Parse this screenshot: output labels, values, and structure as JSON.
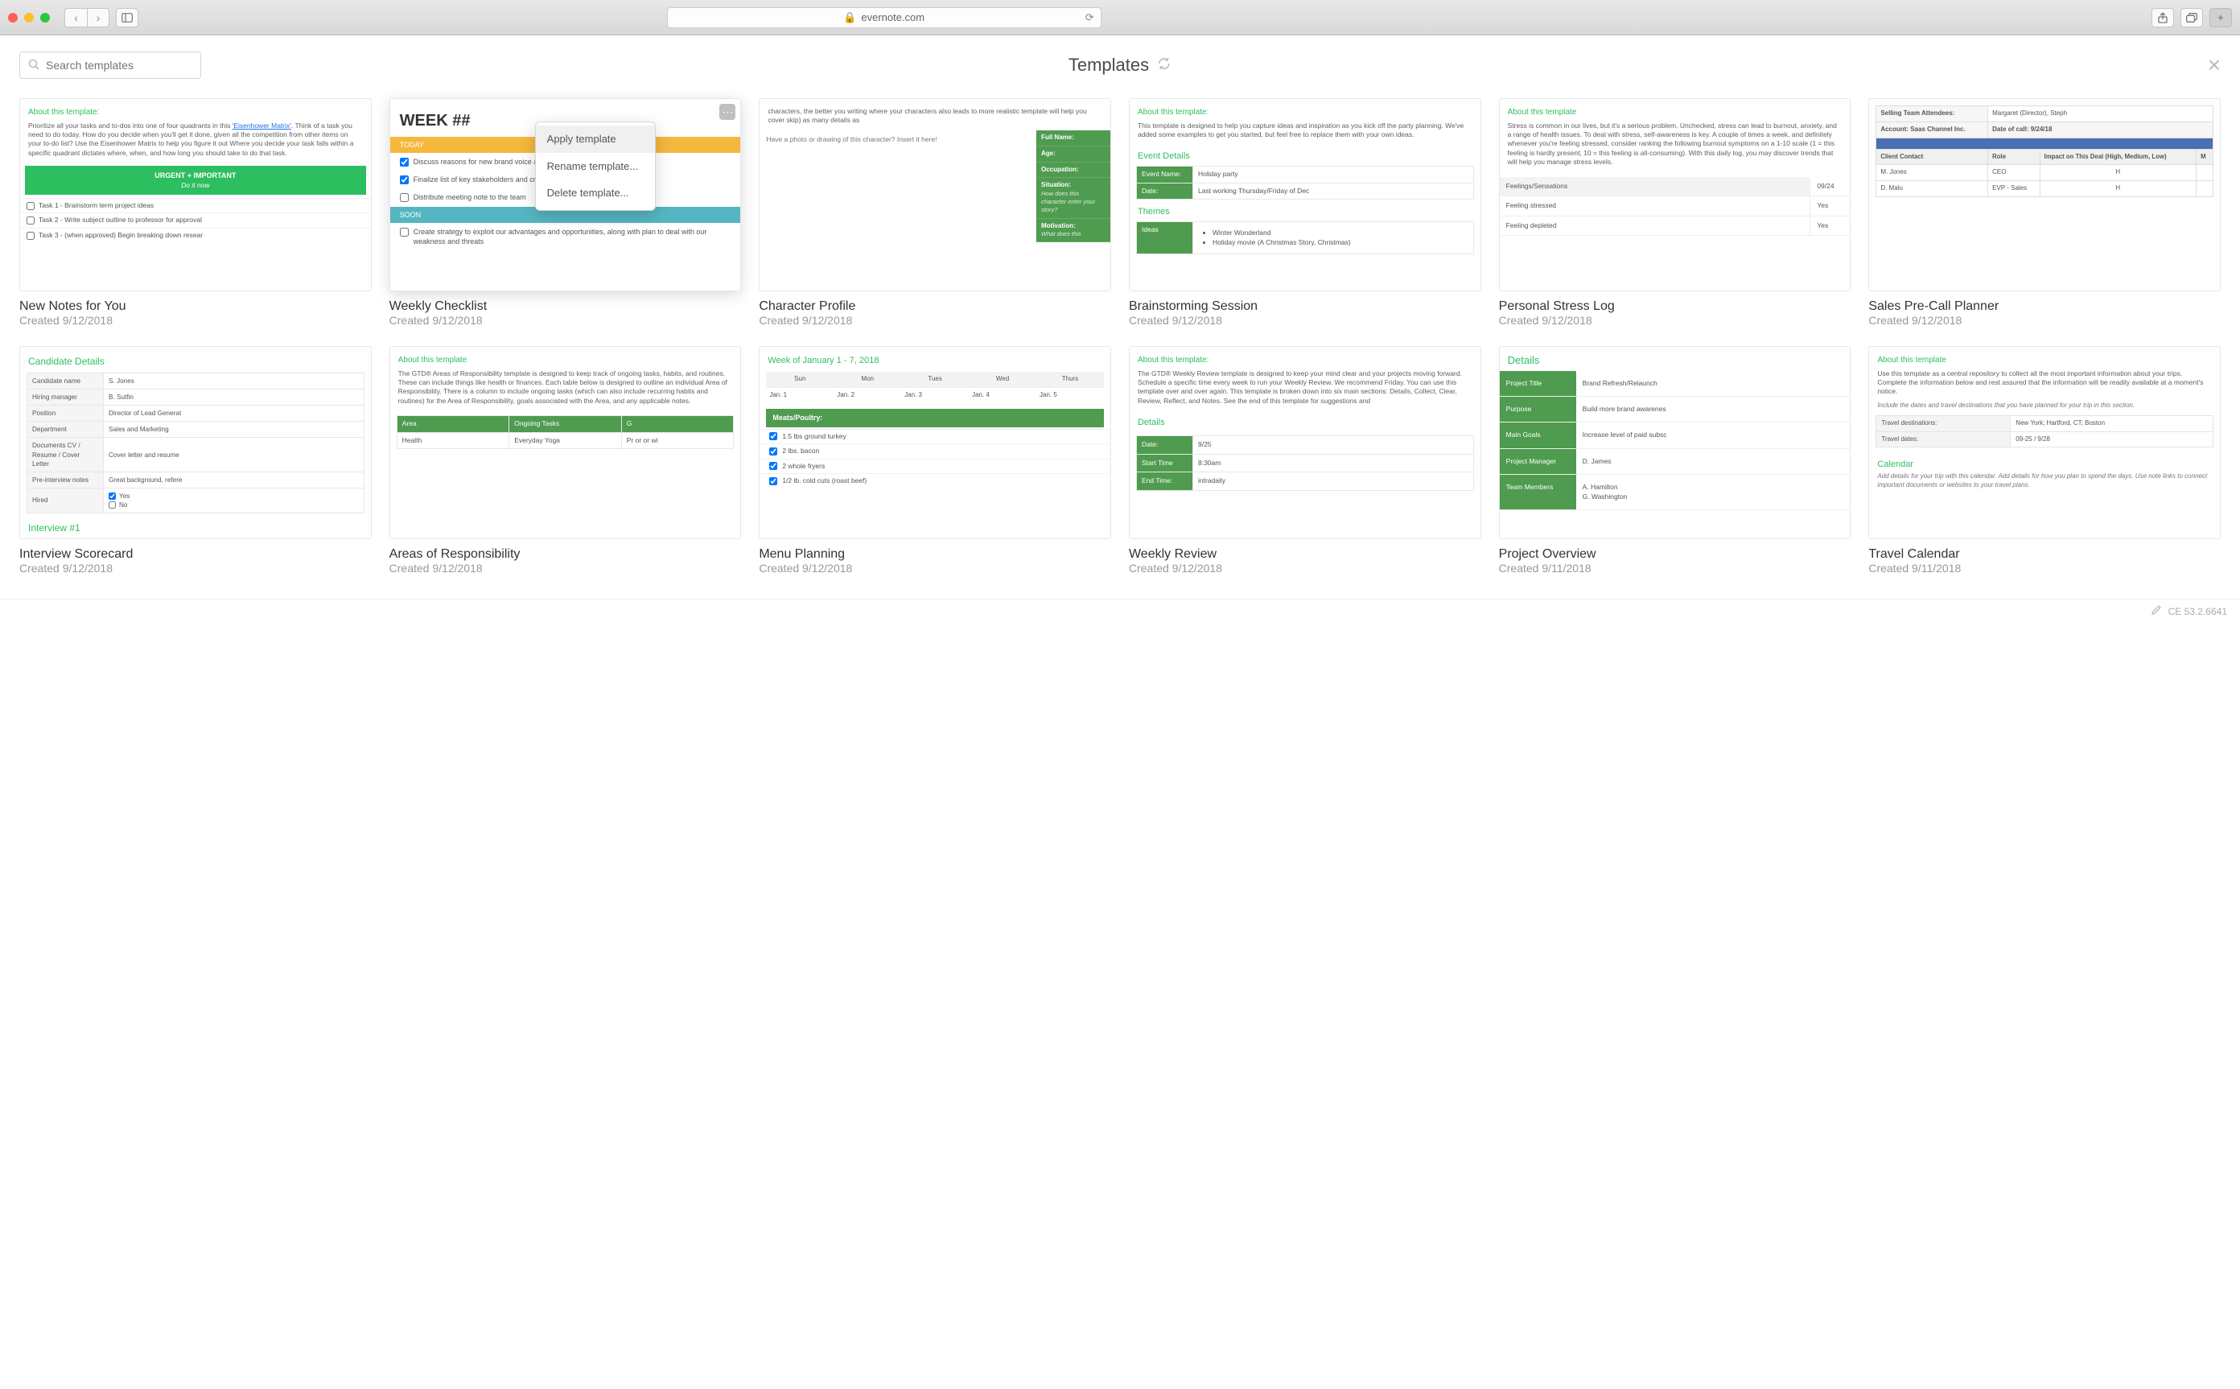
{
  "browser": {
    "url": "evernote.com",
    "share_icon": "share-icon",
    "tabs_icon": "tabs-icon"
  },
  "header": {
    "search_placeholder": "Search templates",
    "title": "Templates"
  },
  "context_menu": {
    "apply": "Apply template",
    "rename": "Rename template...",
    "delete": "Delete template..."
  },
  "footer": {
    "version": "CE 53.2.6641"
  },
  "cards": {
    "new_notes": {
      "title": "New Notes for You",
      "created": "Created 9/12/2018",
      "about": "About this template:",
      "body_pre": "Prioritize all your tasks and to-dos into one of four quadrants in this ",
      "link": "'Eisenhower Matrix'",
      "body_post": ". Think of a task you need to do today. How do you decide when you'll get it done, given all the competition from other items on your to-do list? Use the Eisenhower Matrix to help you figure it out Where you decide your task falls within a specific quadrant dictates where, when, and how long you should take to do that task.",
      "urgent": "URGENT + IMPORTANT",
      "urgent_sub": "Do it now",
      "task1": "Task 1 - Brainstorm term project ideas",
      "task2": "Task 2 - Write subject outline to professor for approval",
      "task3": "Task 3 - (when approved) Begin breaking down resear"
    },
    "weekly_checklist": {
      "title": "Weekly Checklist",
      "created": "Created 9/12/2018",
      "heading": "WEEK ##",
      "today": "TODAY",
      "t1": "Discuss reasons for new brand voice and design for website/app",
      "t2": "Finalize list of key stakeholders and creative team",
      "t3": "Distribute meeting note to the team",
      "soon": "SOON",
      "s1": "Create strategy to exploit our advantages and opportunities, along with plan to deal with our weakness and threats"
    },
    "character_profile": {
      "title": "Character Profile",
      "created": "Created 9/12/2018",
      "body": "characters, the better you writing where your characters also leads to more realistic template will help you cover skip) as many details as",
      "photo": "Have a photo or drawing of this character? Insert it here!",
      "fields": {
        "fullname": "Full Name:",
        "age": "Age:",
        "occupation": "Occupation:",
        "situation": "Situation:",
        "situation_q": "How does this character enter your story?",
        "motivation": "Motivation:",
        "motivation_q": "What does this"
      }
    },
    "brainstorming": {
      "title": "Brainstorming Session",
      "created": "Created 9/12/2018",
      "about": "About this template:",
      "body": "This template is designed to help you capture ideas and inspiration as you kick off the party planning. We've added some examples to get you started, but feel free to replace them with your own ideas.",
      "event_details": "Event Details",
      "event_name_k": "Event Name:",
      "event_name_v": "Holiday party",
      "date_k": "Date:",
      "date_v": "Last working Thursday/Friday of Dec",
      "themes": "Themes",
      "ideas_k": "Ideas",
      "idea1": "Winter Wonderland",
      "idea2": "Holiday movie (A Christmas Story, Christmas)"
    },
    "stress_log": {
      "title": "Personal Stress Log",
      "created": "Created 9/12/2018",
      "about": "About this template",
      "body": "Stress is common in our lives, but it's a serious problem. Unchecked, stress can lead to burnout, anxiety, and a range of health issues. To deal with stress, self-awareness is key. A couple of times a week, and definitely whenever you're feeling stressed, consider ranking the following burnout symptoms on a 1-10 scale (1 = this feeling is hardly present; 10 = this feeling is all-consuming). With this daily log, you may discover trends that will help you manage stress levels.",
      "date": "09/24",
      "feelings_h": "Feelings/Sensations",
      "r1k": "Feeling stressed",
      "r1v": "Yes",
      "r2k": "Feeling depleted",
      "r2v": "Yes"
    },
    "sales": {
      "title": "Sales Pre-Call Planner",
      "created": "Created 9/12/2018",
      "attendees_k": "Selling Team Attendees:",
      "attendees_v": "Margaret (Director), Steph",
      "account_k": "Account: Saas Channel Inc.",
      "datecall_k": "Date of call: 9/24/18",
      "col1": "Client Contact",
      "col2": "Role",
      "col3": "Impact on This Deal (High, Medium, Low)",
      "col4": "M",
      "r1c1": "M. Jones",
      "r1c2": "CEO",
      "r1c3": "H",
      "r2c1": "D. Malu",
      "r2c2": "EVP - Sales",
      "r2c3": "H"
    },
    "interview": {
      "title": "Interview Scorecard",
      "created": "Created 9/12/2018",
      "details": "Candidate Details",
      "rows": {
        "name_k": "Candidate name",
        "name_v": "S. Jones",
        "hm_k": "Hiring manager",
        "hm_v": "B. Sutfin",
        "pos_k": "Position",
        "pos_v": "Director of Lead Generat",
        "dept_k": "Department",
        "dept_v": "Sales and Marketing",
        "docs_k": "Documents CV / Resume / Cover Letter",
        "docs_v": "Cover letter and resume",
        "notes_k": "Pre-interview notes",
        "notes_v": "Great background, refere",
        "hired_k": "Hired",
        "hired_yes": "Yes",
        "hired_no": "No"
      },
      "interview1": "Interview #1"
    },
    "areas": {
      "title": "Areas of Responsibility",
      "created": "Created 9/12/2018",
      "about": "About this template",
      "body": "The GTD® Areas of Responsibility template is designed to keep track of ongoing tasks, habits, and routines. These can include things like health or finances. Each table below is designed to outline an individual Area of Responsibility. There is a column to include ongoing tasks (which can also include recurring habits and routines) for the Area of Responsibility, goals associated with the Area, and any applicable notes.",
      "col1": "Area",
      "col2": "Ongoing Tasks",
      "col3": "G",
      "r1c1": "Health",
      "r1c2": "Everyday Yoga",
      "r1c3": "Pr or or wi"
    },
    "menu": {
      "title": "Menu Planning",
      "created": "Created 9/12/2018",
      "week": "Week of January 1 - 7, 2018",
      "days": [
        "Sun",
        "Mon",
        "Tues",
        "Wed",
        "Thurs"
      ],
      "dates": [
        "Jan. 1",
        "Jan. 2",
        "Jan. 3",
        "Jan. 4",
        "Jan. 5"
      ],
      "cat": "Meats/Poultry:",
      "i1": "1.5 lbs ground turkey",
      "i2": "2 lbs. bacon",
      "i3": "2 whole fryers",
      "i4": "1/2 lb. cold cuts (roast beef)"
    },
    "weekly_review": {
      "title": "Weekly Review",
      "created": "Created 9/12/2018",
      "about": "About this template:",
      "body": "The GTD® Weekly Review template is designed to keep your mind clear and your projects moving forward. Schedule a specific time every week to run your Weekly Review. We recommend Friday. You can use this template over and over again. This template is broken down into six main sections: Details, Collect, Clear, Review, Reflect, and Notes.  See the end of this template for suggestions and",
      "details": "Details",
      "date_k": "Date:",
      "date_v": "9/25",
      "start_k": "Start Time",
      "start_v": "8:30am",
      "end_k": "End Time:",
      "end_v": "intradaily"
    },
    "project": {
      "title": "Project Overview",
      "created": "Created 9/11/2018",
      "details": "Details",
      "pt_k": "Project Title",
      "pt_v": "Brand Refresh/Relaunch",
      "purpose_k": "Purpose",
      "purpose_v": "Build more brand awarenes",
      "goals_k": "Main Goals",
      "goals_v": "Increase level of paid subsc",
      "pm_k": "Project Manager",
      "pm_v": "D. James",
      "team_k": "Team Members",
      "team_v1": "A. Hamilton",
      "team_v2": "G. Washington"
    },
    "travel": {
      "title": "Travel Calendar",
      "created": "Created 9/11/2018",
      "about": "About this template",
      "body": "Use this template as a central repository to collect all the most important information about your trips. Complete the information below and rest assured that the information will be readily available at a moment's notice.",
      "note1": "Include the dates and travel destinations that you have planned for your trip in this section.",
      "dest_k": "Travel destinations:",
      "dest_v": "New York; Hartford, CT; Boston",
      "dates_k": "Travel dates:",
      "dates_v": "09-25 / 9/28",
      "calendar": "Calendar",
      "cal_note": "Add details for your trip with this calendar. Add details for how you plan to spend the days. Use note links to connect important documents or websites to your travel plans."
    }
  }
}
